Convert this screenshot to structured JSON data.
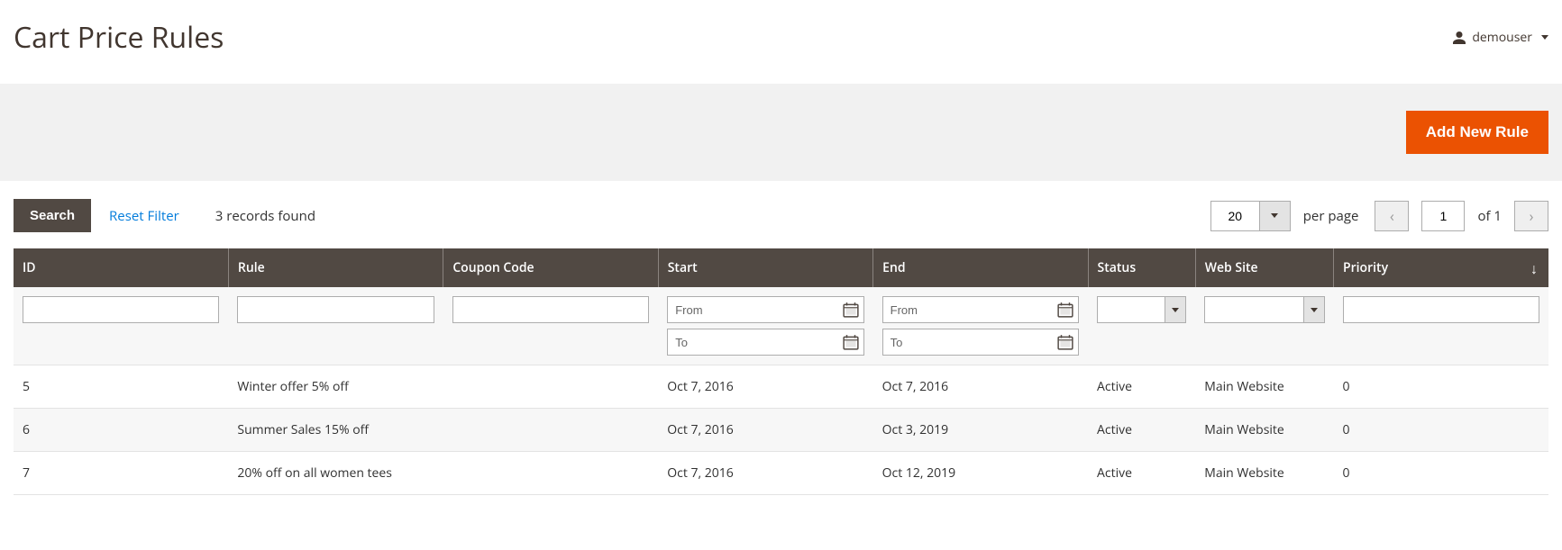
{
  "header": {
    "title": "Cart Price Rules",
    "user": "demouser"
  },
  "actions": {
    "add_new": "Add New Rule"
  },
  "toolbar": {
    "search": "Search",
    "reset_filter": "Reset Filter",
    "records_found": "3 records found",
    "per_page_value": "20",
    "per_page_label": "per page",
    "page_value": "1",
    "page_of": "of 1"
  },
  "columns": {
    "id": "ID",
    "rule": "Rule",
    "coupon": "Coupon Code",
    "start": "Start",
    "end": "End",
    "status": "Status",
    "website": "Web Site",
    "priority": "Priority"
  },
  "filters": {
    "from": "From",
    "to": "To"
  },
  "rows": [
    {
      "id": "5",
      "rule": "Winter offer 5% off",
      "coupon": "",
      "start": "Oct 7, 2016",
      "end": "Oct 7, 2016",
      "status": "Active",
      "website": "Main Website",
      "priority": "0"
    },
    {
      "id": "6",
      "rule": "Summer Sales 15% off",
      "coupon": "",
      "start": "Oct 7, 2016",
      "end": "Oct 3, 2019",
      "status": "Active",
      "website": "Main Website",
      "priority": "0"
    },
    {
      "id": "7",
      "rule": "20% off on all women tees",
      "coupon": "",
      "start": "Oct 7, 2016",
      "end": "Oct 12, 2019",
      "status": "Active",
      "website": "Main Website",
      "priority": "0"
    }
  ]
}
